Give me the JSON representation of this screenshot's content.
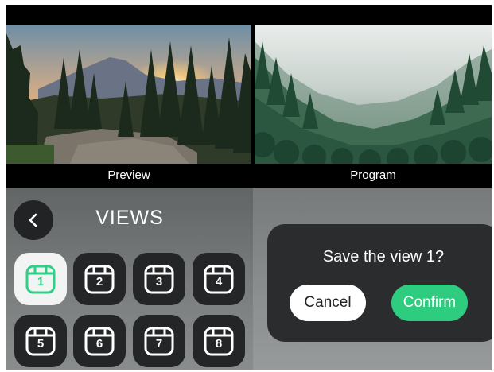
{
  "monitors": {
    "preview": {
      "label": "Preview"
    },
    "program": {
      "label": "Program"
    }
  },
  "views_panel": {
    "title": "VIEWS",
    "back_icon": "chevron-left-icon",
    "selected_view": "1",
    "views": [
      {
        "number": "1",
        "icon": "calendar-icon"
      },
      {
        "number": "2",
        "icon": "calendar-icon"
      },
      {
        "number": "3",
        "icon": "calendar-icon"
      },
      {
        "number": "4",
        "icon": "calendar-icon"
      },
      {
        "number": "5",
        "icon": "calendar-icon"
      },
      {
        "number": "6",
        "icon": "calendar-icon"
      },
      {
        "number": "7",
        "icon": "calendar-icon"
      },
      {
        "number": "8",
        "icon": "calendar-icon"
      }
    ]
  },
  "dialog": {
    "message": "Save the view 1?",
    "cancel_label": "Cancel",
    "confirm_label": "Confirm"
  },
  "colors": {
    "accent": "#2ecc7f",
    "dialog_bg": "#2b2c2d",
    "button_bg": "#242526"
  }
}
